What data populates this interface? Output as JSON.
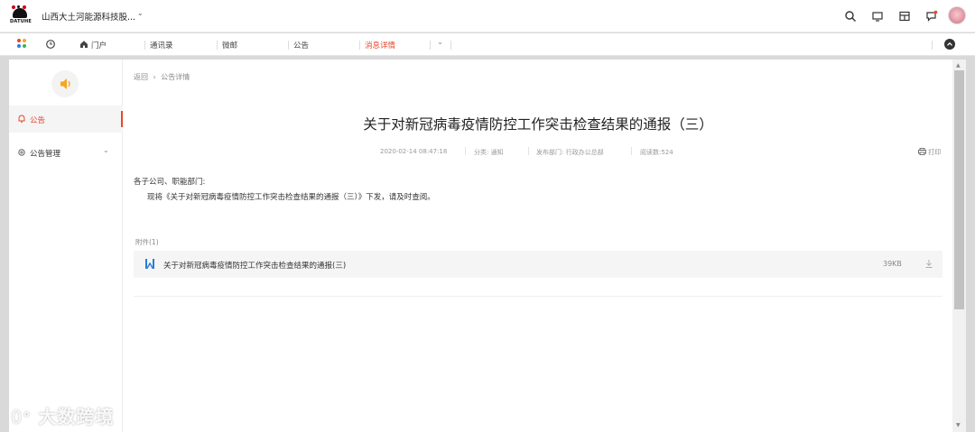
{
  "header": {
    "logo_text": "DATUHE",
    "company": "山西大土河能源科技股...",
    "icons": [
      "search-icon",
      "monitor-icon",
      "layout-icon",
      "message-icon",
      "avatar"
    ]
  },
  "tabs": [
    {
      "label": "门户"
    },
    {
      "label": "通讯录"
    },
    {
      "label": "微邮"
    },
    {
      "label": "公告"
    },
    {
      "label": "消息详情",
      "active": true
    }
  ],
  "sidebar": {
    "items": [
      {
        "label": "公告",
        "active": true
      },
      {
        "label": "公告管理"
      }
    ]
  },
  "breadcrumb": {
    "back": "返回",
    "current": "公告详情"
  },
  "article": {
    "title": "关于对新冠病毒疫情防控工作突击检查结果的通报（三）",
    "date": "2020-02-14 08:47:18",
    "category": "分类: 通知",
    "department": "发布部门: 行政办公总部",
    "views": "阅读数:524",
    "print_label": "打印",
    "greeting": "各子公司、职能部门:",
    "body": "现将《关于对新冠病毒疫情防控工作突击检查结果的通报（三）》下发，请及时查阅。"
  },
  "attachments": {
    "label": "附件(1)",
    "items": [
      {
        "name": "关于对新冠病毒疫情防控工作突击检查结果的通报(三)",
        "size": "39KB"
      }
    ]
  },
  "colors": {
    "accent": "#e8462b",
    "word_blue": "#2b7cd9",
    "speaker_orange": "#f5a623"
  },
  "brand_watermark": "大数跨境"
}
